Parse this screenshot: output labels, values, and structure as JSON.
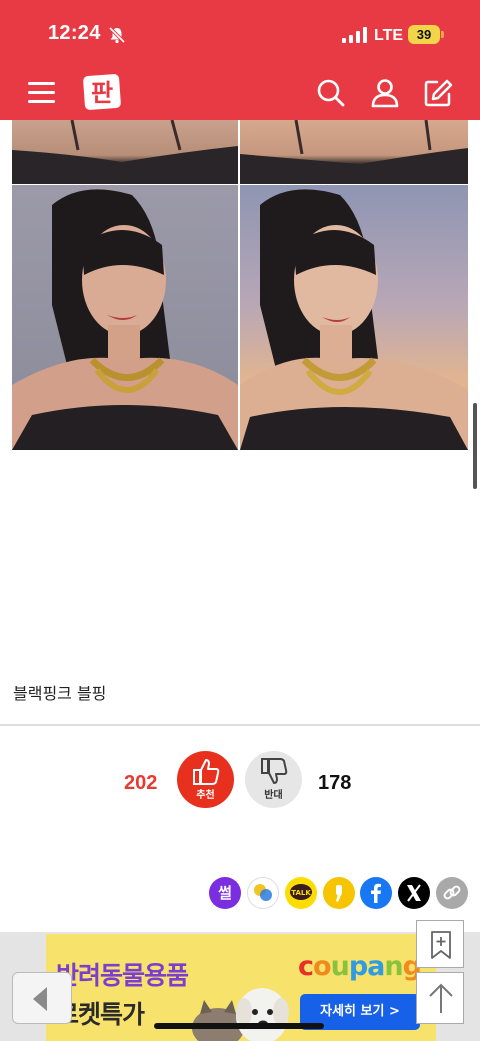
{
  "status_bar": {
    "time": "12:24",
    "network": "LTE",
    "battery": "39"
  },
  "header": {
    "logo_text": "판"
  },
  "post": {
    "caption": "블랙핑크 블핑"
  },
  "votes": {
    "up_count": "202",
    "up_label": "추천",
    "down_count": "178",
    "down_label": "반대"
  },
  "share": {
    "ssul_label": "썰",
    "kakao_label": "TALK"
  },
  "ad": {
    "line1": "반려동물용품",
    "line2": "로켓특가",
    "brand": "coupang",
    "cta": "자세히 보기 >",
    "brand_colors": [
      "#e8302b",
      "#f08a1c",
      "#8ac23e",
      "#2f9be0",
      "#2f9be0",
      "#8ac23e",
      "#f08a1c"
    ]
  },
  "colors": {
    "header_bg": "#e83a44",
    "vote_up": "#e8301f",
    "vote_up_count": "#e83a2e"
  }
}
